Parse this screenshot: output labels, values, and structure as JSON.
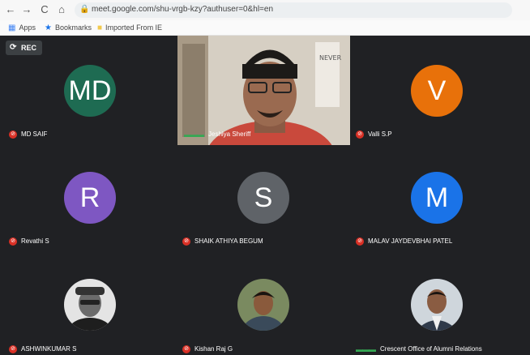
{
  "browser": {
    "back_icon": "←",
    "forward_icon": "→",
    "reload_icon": "C",
    "home_icon": "⌂",
    "url": "meet.google.com/shu-vrgb-kzy?authuser=0&hl=en"
  },
  "bookmarks": [
    {
      "icon": "apps-icon",
      "label": "Apps"
    },
    {
      "icon": "star-icon",
      "label": "Bookmarks"
    },
    {
      "icon": "folder-icon",
      "label": "Imported From IE"
    }
  ],
  "meeting": {
    "rec_label": "REC",
    "accent_colors": {
      "muted": "#d93025",
      "speaking": "#34a853"
    },
    "participants": [
      {
        "initials": "MD",
        "name": "MD SAIF",
        "color": "#1e6b52",
        "muted": true
      },
      {
        "initials": "",
        "name": "Jeshiya Sheriff",
        "color": "",
        "muted": false,
        "video": true
      },
      {
        "initials": "V",
        "name": "Valli S.P",
        "color": "#e8710a",
        "muted": true
      },
      {
        "initials": "R",
        "name": "Revathi S",
        "color": "#7e57c2",
        "muted": true
      },
      {
        "initials": "S",
        "name": "SHAIK ATHIYA BEGUM",
        "color": "#5f6368",
        "muted": true
      },
      {
        "initials": "M",
        "name": "MALAV JAYDEVBHAI PATEL",
        "color": "#1a73e8",
        "muted": true
      },
      {
        "initials": "",
        "name": "ASHWINKUMAR S",
        "color": "",
        "muted": true,
        "photo": true
      },
      {
        "initials": "",
        "name": "Kishan Raj G",
        "color": "",
        "muted": true,
        "photo": true
      },
      {
        "initials": "",
        "name": "Crescent Office of Alumni Relations",
        "color": "",
        "muted": false,
        "photo": true
      }
    ]
  }
}
